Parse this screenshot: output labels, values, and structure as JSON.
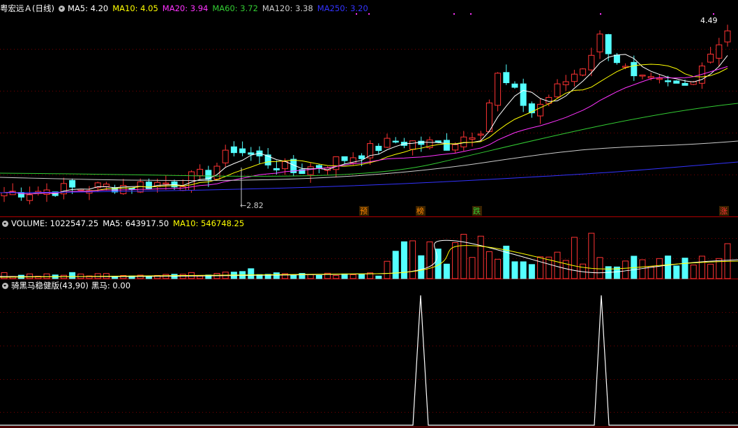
{
  "price_panel": {
    "title": "粤宏远Ａ(日线)",
    "ma_labels": [
      {
        "text": "MA5: 4.20",
        "color": "#ffffff"
      },
      {
        "text": "MA10: 4.05",
        "color": "#ffff00"
      },
      {
        "text": "MA20: 3.94",
        "color": "#ff33ff"
      },
      {
        "text": "MA60: 3.72",
        "color": "#33cc33"
      },
      {
        "text": "MA120: 3.38",
        "color": "#cccccc"
      },
      {
        "text": "MA250: 3.20",
        "color": "#3333ff"
      }
    ],
    "high_label": "4.49",
    "low_label": "2.82",
    "markers": [
      {
        "text": "预",
        "color": "#ff8800"
      },
      {
        "text": "榜",
        "color": "#ff8800"
      },
      {
        "text": "跌",
        "color": "#33cc33"
      },
      {
        "text": "涨",
        "color": "#ff3333"
      }
    ]
  },
  "volume_panel": {
    "labels": [
      {
        "text": "VOLUME: 1022547.25",
        "color": "#ffffff"
      },
      {
        "text": "MA5: 643917.50",
        "color": "#ffffff"
      },
      {
        "text": "MA10: 546748.25",
        "color": "#ffff00"
      }
    ]
  },
  "indicator_panel": {
    "title": "骑黑马稳健版(43,90)",
    "value_label": "黑马: 0.00"
  },
  "colors": {
    "up": "#ff3333",
    "down": "#54ffff",
    "ma5": "#ffffff",
    "ma10": "#ffff00",
    "ma20": "#ff33ff",
    "ma60": "#33cc33",
    "ma120": "#cccccc",
    "ma250": "#3333ff"
  },
  "chart_data": {
    "type": "candlestick",
    "price_range_visible": {
      "min": 2.82,
      "max": 4.49
    },
    "volume_ma5": 643917.5,
    "volume_ma10": 546748.25,
    "last_volume": 1022547.25,
    "indicator_signals": "two spikes"
  }
}
